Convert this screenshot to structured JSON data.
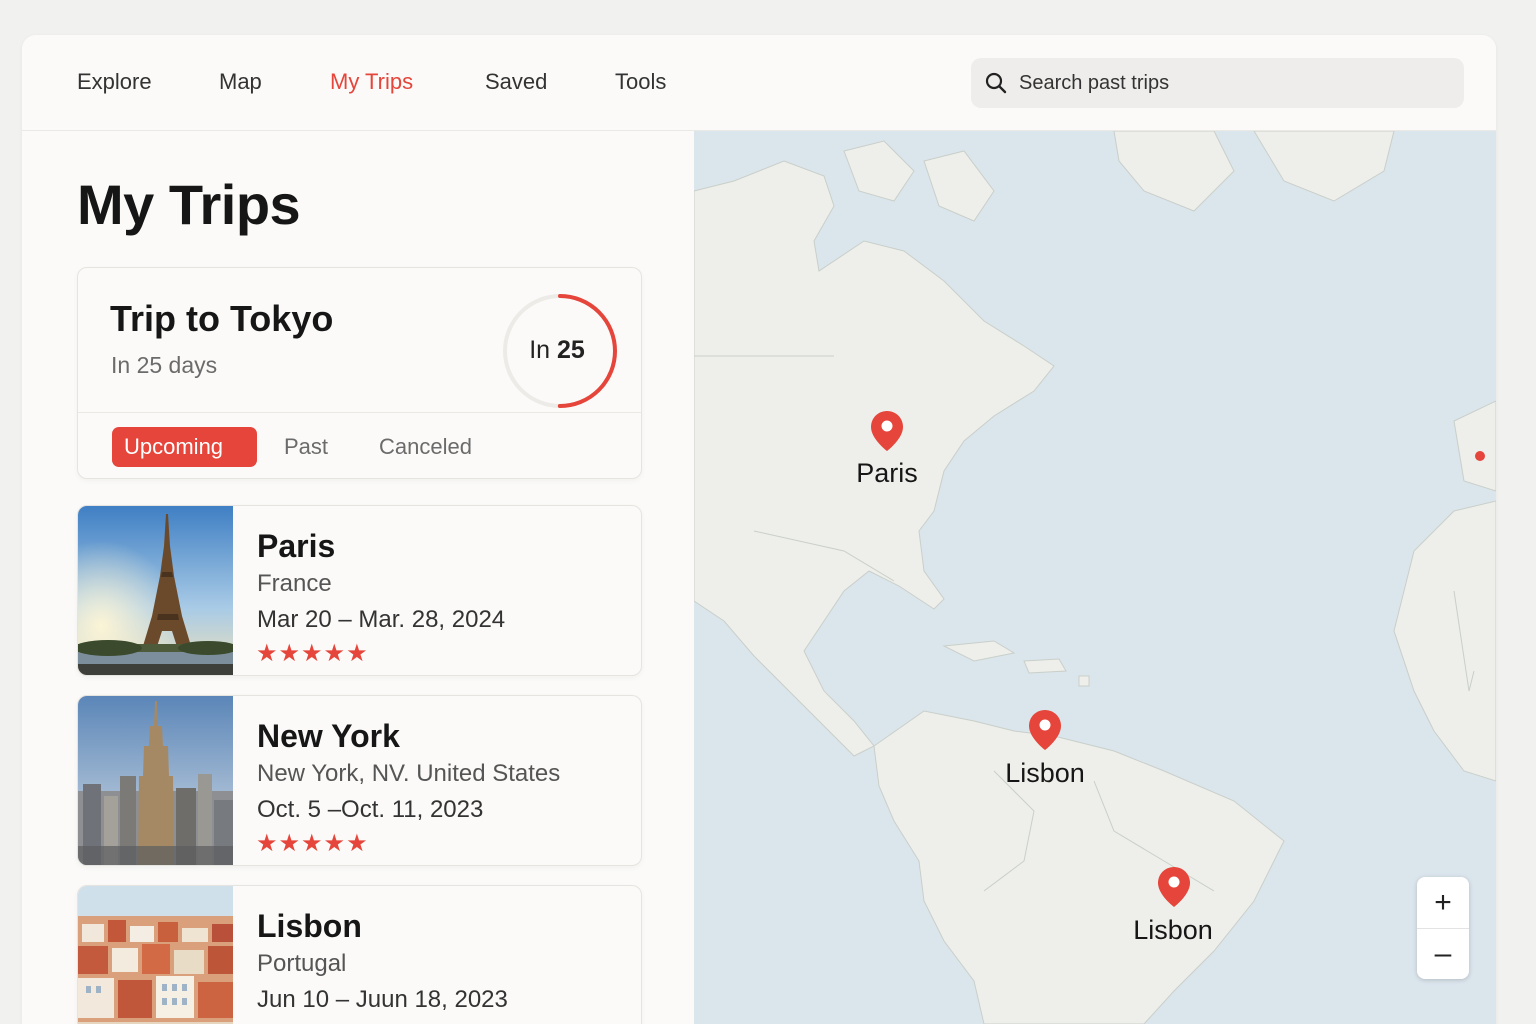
{
  "nav": {
    "items": [
      {
        "label": "Explore"
      },
      {
        "label": "Map"
      },
      {
        "label": "My Trips",
        "active": true
      },
      {
        "label": "Saved"
      },
      {
        "label": "Tools"
      }
    ],
    "search": {
      "placeholder": "Search past trips",
      "icon": "search-icon"
    }
  },
  "page": {
    "title": "My Trips"
  },
  "upcoming": {
    "title": "Trip to Tokyo",
    "subtitle": "In 25 days",
    "ring_prefix": "In",
    "ring_value": "25",
    "ring_progress": 0.5,
    "tabs": [
      {
        "label": "Upcoming",
        "active": true
      },
      {
        "label": "Past"
      },
      {
        "label": "Canceled"
      }
    ]
  },
  "trips": [
    {
      "name": "Paris",
      "country": "France",
      "dates": "Mar 20 – Mar. 28, 2024",
      "rating": 5,
      "stars": "★★★★★"
    },
    {
      "name": "New York",
      "country": "New York,  NV. United States",
      "dates": "Oct. 5 –Oct. 11, 2023",
      "rating": 5,
      "stars": "★★★★★"
    },
    {
      "name": "Lisbon",
      "country": "Portugal",
      "dates": "Jun 10 – Juun 18, 2023"
    }
  ],
  "map": {
    "pins": [
      {
        "label": "Paris"
      },
      {
        "label": "Lisbon"
      },
      {
        "label": "Lisbon"
      }
    ],
    "zoom_in": "+",
    "zoom_out": "–"
  },
  "colors": {
    "accent": "#e5453a",
    "map_water": "#dbe5ec",
    "map_land": "#eeefea"
  }
}
